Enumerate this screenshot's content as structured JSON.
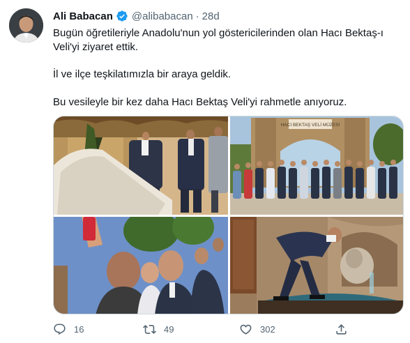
{
  "tweet": {
    "author_name": "Ali Babacan",
    "handle": "@alibabacan",
    "separator": "·",
    "time": "28d",
    "text": {
      "line1": "Bugün öğretileriyle Anadolu'nun yol göstericilerinden olan Hacı Bektaş-ı Veli'yi ziyaret ettik.",
      "line2": "İl ve ilçe teşkilatımızla bir araya geldik.",
      "line3": "Bu vesileyle bir kez daha Hacı Bektaş Veli'yi rahmetle anıyoruz."
    },
    "photos": {
      "museum_sign": "HACI BEKTAŞ VELİ MÜZESİ"
    },
    "actions": {
      "reply_count": "16",
      "retweet_count": "49",
      "like_count": "302"
    },
    "icons": {
      "verified": "verified-badge-icon",
      "reply": "reply-icon",
      "retweet": "retweet-icon",
      "like": "heart-icon",
      "share": "share-icon"
    },
    "colors": {
      "verified": "#1d9bf0",
      "secondary_text": "#536471",
      "primary_text": "#0f1419"
    }
  }
}
